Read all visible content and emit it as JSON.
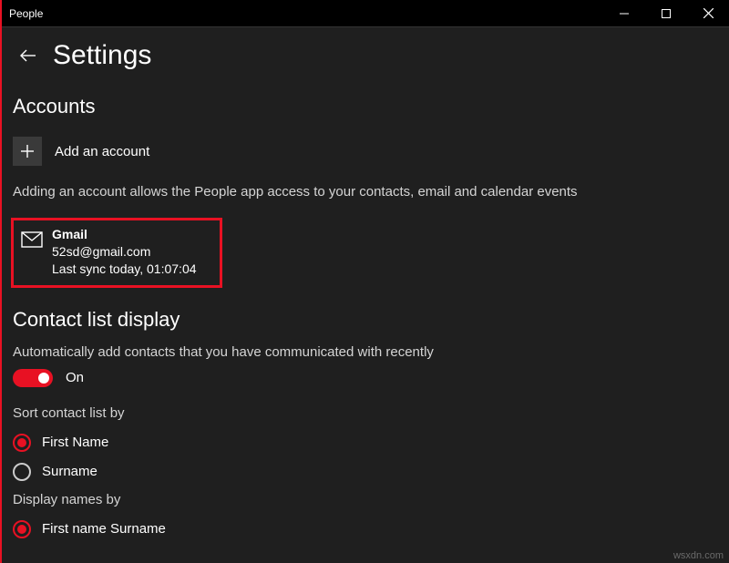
{
  "window": {
    "title": "People"
  },
  "page": {
    "title": "Settings"
  },
  "accounts": {
    "heading": "Accounts",
    "add_label": "Add an account",
    "help": "Adding an account allows the People app access to your contacts, email and calendar events",
    "item": {
      "name": "Gmail",
      "email": "52sd@gmail.com",
      "sync": "Last sync today, 01:07:04"
    }
  },
  "contact_display": {
    "heading": "Contact list display",
    "auto_add_label": "Automatically add contacts that you have communicated with recently",
    "auto_add_state": "On",
    "sort_label": "Sort contact list by",
    "sort_options": {
      "first": "First Name",
      "surname": "Surname"
    },
    "display_names_label": "Display names by",
    "display_names_option": "First name Surname"
  },
  "watermark": "wsxdn.com"
}
